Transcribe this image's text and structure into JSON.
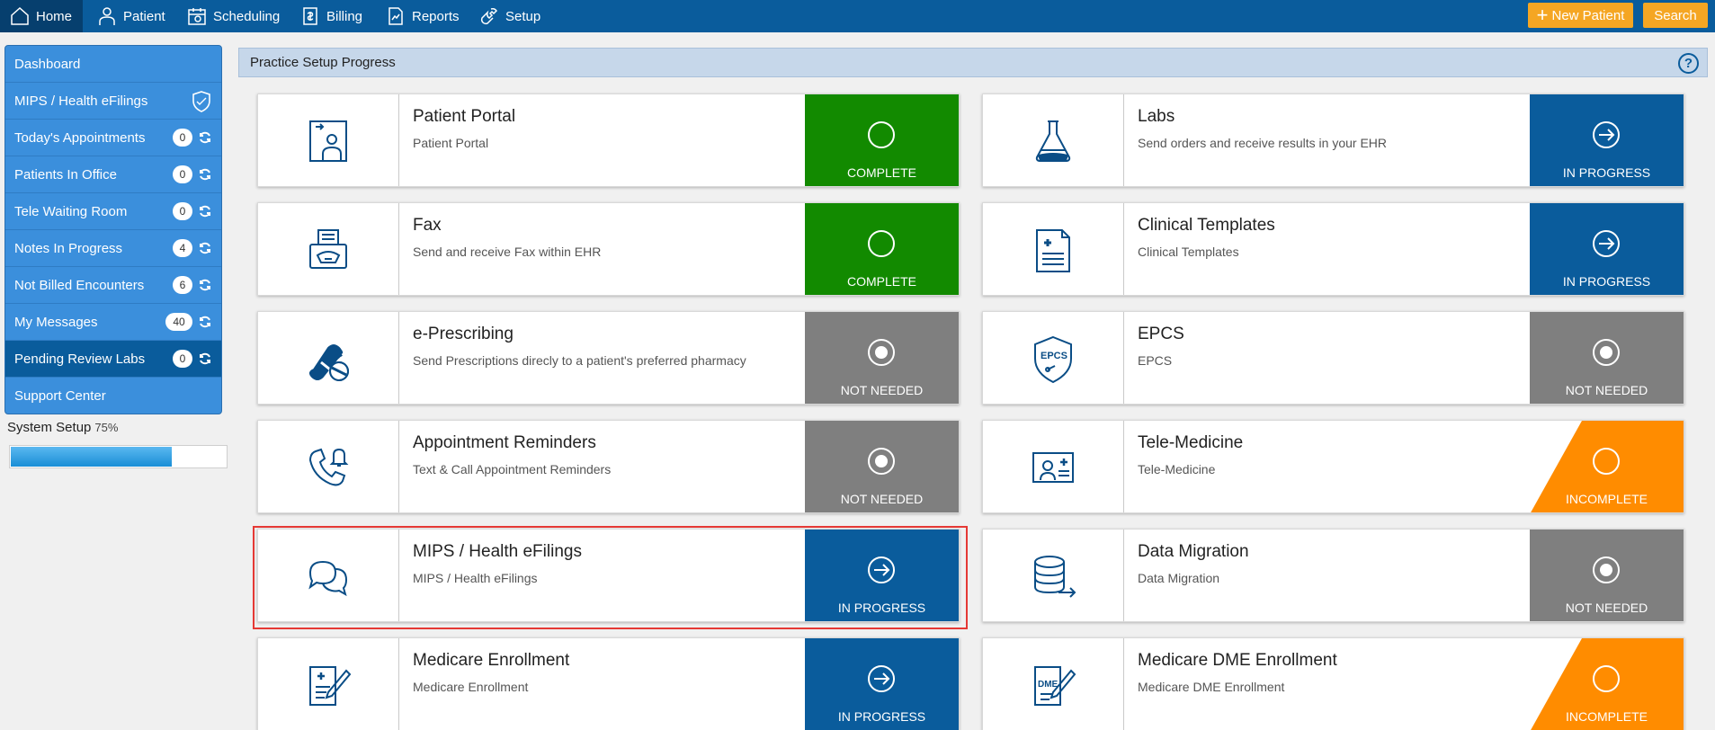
{
  "nav": {
    "items": [
      {
        "label": "Home",
        "icon": "home-icon"
      },
      {
        "label": "Patient",
        "icon": "patient-icon"
      },
      {
        "label": "Scheduling",
        "icon": "calendar-icon"
      },
      {
        "label": "Billing",
        "icon": "billing-icon"
      },
      {
        "label": "Reports",
        "icon": "reports-icon"
      },
      {
        "label": "Setup",
        "icon": "wrench-icon"
      }
    ],
    "new_patient": "New Patient",
    "search": "Search"
  },
  "sidebar": {
    "items": [
      {
        "label": "Dashboard"
      },
      {
        "label": "MIPS / Health eFilings"
      },
      {
        "label": "Today's Appointments",
        "count": "0"
      },
      {
        "label": "Patients In Office",
        "count": "0"
      },
      {
        "label": "Tele Waiting Room",
        "count": "0"
      },
      {
        "label": "Notes In Progress",
        "count": "4"
      },
      {
        "label": "Not Billed Encounters",
        "count": "6"
      },
      {
        "label": "My Messages",
        "count": "40"
      },
      {
        "label": "Pending Review Labs",
        "count": "0"
      },
      {
        "label": "Support Center"
      }
    ]
  },
  "system_setup": {
    "label": "System Setup",
    "percent": "75%",
    "progress": 0.75
  },
  "panel": {
    "title": "Practice Setup Progress",
    "help": "?"
  },
  "cards": [
    {
      "title": "Patient Portal",
      "desc": "Patient Portal",
      "status": "COMPLETE",
      "icon": "portal-icon"
    },
    {
      "title": "Labs",
      "desc": "Send orders and receive results in your EHR",
      "status": "IN PROGRESS",
      "icon": "flask-icon"
    },
    {
      "title": "Fax",
      "desc": "Send and receive Fax within EHR",
      "status": "COMPLETE",
      "icon": "fax-icon"
    },
    {
      "title": "Clinical Templates",
      "desc": "Clinical Templates",
      "status": "IN PROGRESS",
      "icon": "document-icon"
    },
    {
      "title": "e-Prescribing",
      "desc": "Send Prescriptions direcly to a patient's preferred pharmacy",
      "status": "NOT NEEDED",
      "icon": "pills-icon"
    },
    {
      "title": "EPCS",
      "desc": "EPCS",
      "status": "NOT NEEDED",
      "icon": "epcs-shield-icon"
    },
    {
      "title": "Appointment Reminders",
      "desc": "Text & Call Appointment Reminders",
      "status": "NOT NEEDED",
      "icon": "phone-bell-icon"
    },
    {
      "title": "Tele-Medicine",
      "desc": "Tele-Medicine",
      "status": "INCOMPLETE",
      "icon": "telemedicine-icon"
    },
    {
      "title": "MIPS / Health eFilings",
      "desc": "MIPS / Health eFilings",
      "status": "IN PROGRESS",
      "icon": "chat-bubbles-icon"
    },
    {
      "title": "Data Migration",
      "desc": "Data Migration",
      "status": "NOT NEEDED",
      "icon": "database-icon"
    },
    {
      "title": "Medicare Enrollment",
      "desc": "Medicare Enrollment",
      "status": "IN PROGRESS",
      "icon": "form-pen-icon"
    },
    {
      "title": "Medicare DME Enrollment",
      "desc": "Medicare DME Enrollment",
      "status": "INCOMPLETE",
      "icon": "dme-form-icon"
    }
  ],
  "colors": {
    "nav_bg": "#0a5c9c",
    "sidebar_bg": "#3b8fdc",
    "complete": "#128a00",
    "in_progress": "#0a5c9c",
    "not_needed": "#7f7f7f",
    "incomplete": "#ff8c00",
    "accent_orange": "#f5a623"
  }
}
